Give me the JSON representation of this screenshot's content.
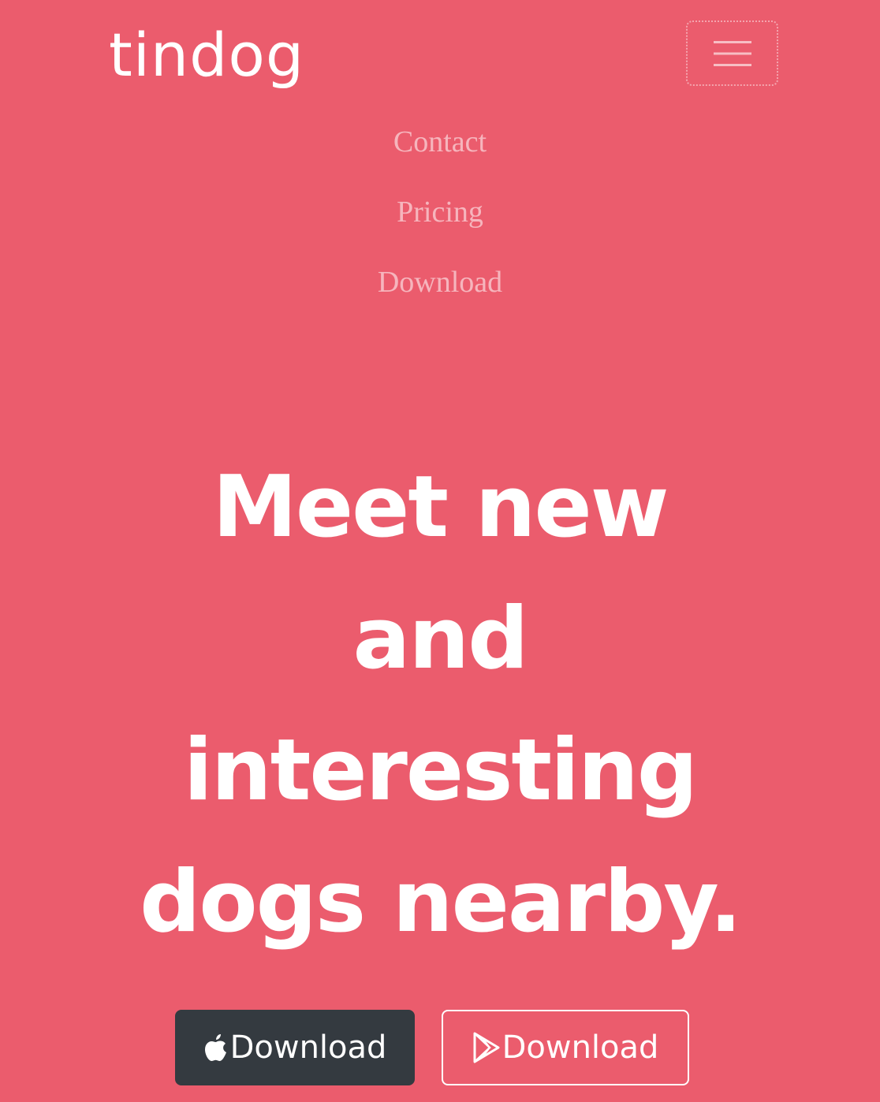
{
  "navbar": {
    "brand": "tindog",
    "toggler_icon": "hamburger-icon",
    "links": [
      "Contact",
      "Pricing",
      "Download"
    ]
  },
  "hero": {
    "title_lines": [
      "Meet new",
      "and",
      "interesting",
      "dogs nearby."
    ]
  },
  "buttons": {
    "apple": {
      "label": "Download",
      "icon": "apple-icon"
    },
    "google_play": {
      "label": "Download",
      "icon": "google-play-icon"
    }
  },
  "colors": {
    "background": "#eb5c6d",
    "dark_button": "#343a40",
    "text": "#ffffff"
  }
}
